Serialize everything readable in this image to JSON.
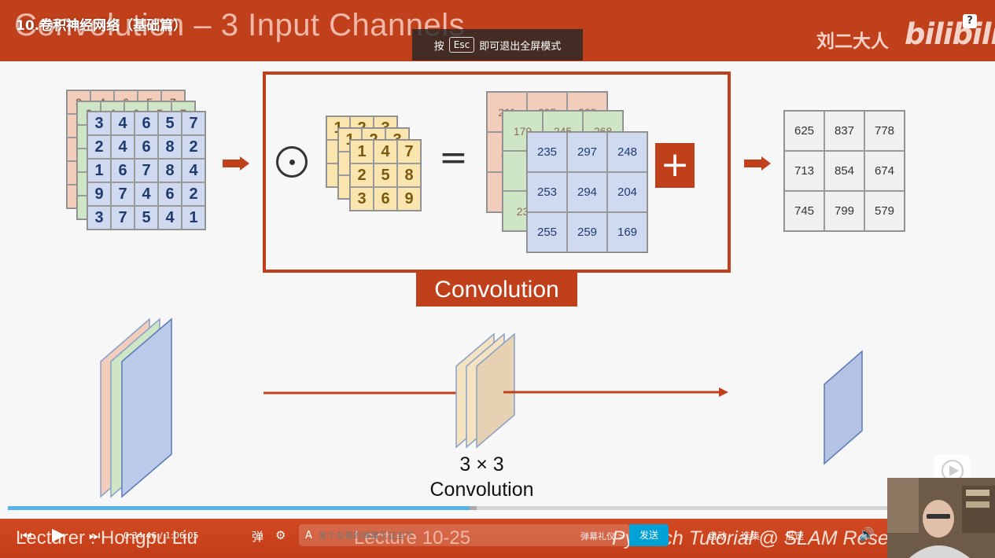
{
  "player": {
    "video_title": "10.卷积神经网络（基础篇）",
    "help_label": "?",
    "esc_toast": {
      "prefix": "按",
      "key": "Esc",
      "suffix": "即可退出全屏模式"
    },
    "watermark_author": "刘二大人",
    "watermark_logo": "bilibili"
  },
  "slide": {
    "title": "Convolution – 3 Input Channels",
    "conv_label": "Convolution",
    "caption_line1": "3 × 3",
    "caption_line2": "Convolution",
    "footer_lecturer": "Lecturer : Hongpu Liu",
    "footer_lecture": "Lecture 10-25",
    "footer_tutorial": "PyTorch Tutorial @ SLAM Resea",
    "input_back_pink": [
      "3",
      "4",
      "6",
      "5",
      "7"
    ],
    "input_back_green": [
      "3",
      "4",
      "6",
      "5",
      "7"
    ],
    "input_front": [
      [
        "3",
        "4",
        "6",
        "5",
        "7"
      ],
      [
        "2",
        "4",
        "6",
        "8",
        "2"
      ],
      [
        "1",
        "6",
        "7",
        "8",
        "4"
      ],
      [
        "9",
        "7",
        "4",
        "6",
        "2"
      ],
      [
        "3",
        "7",
        "5",
        "4",
        "1"
      ]
    ],
    "kernel_back": [
      "1",
      "2",
      "3"
    ],
    "kernel_front": [
      [
        "1",
        "4",
        "7"
      ],
      [
        "2",
        "5",
        "8"
      ],
      [
        "3",
        "6",
        "9"
      ]
    ],
    "result_pink": [
      "211",
      "295",
      "262"
    ],
    "result_green": [
      "179",
      "245",
      "268"
    ],
    "result_pink_left": [
      "2",
      "20",
      "2"
    ],
    "result_green_left": [
      "23"
    ],
    "result_front": [
      [
        "235",
        "297",
        "248"
      ],
      [
        "253",
        "294",
        "204"
      ],
      [
        "255",
        "259",
        "169"
      ]
    ],
    "output": [
      [
        "625",
        "837",
        "778"
      ],
      [
        "713",
        "854",
        "674"
      ],
      [
        "745",
        "799",
        "579"
      ]
    ]
  },
  "controls": {
    "time_current": "0:34:46",
    "time_total": "1:06:05",
    "time_sep": "/",
    "danmaku_placeholder": "发个友善的弹幕见证当下",
    "gift_label": "弹幕礼仪 >",
    "send_label": "发送",
    "auto_label": "自动",
    "quality_label": "选集",
    "speed_label": "倍速",
    "progress_played": 0.524,
    "progress_buffered": 0.532
  },
  "colors": {
    "accent": "#c0401b",
    "progress": "#58b4e6",
    "send": "#00a1d6"
  }
}
